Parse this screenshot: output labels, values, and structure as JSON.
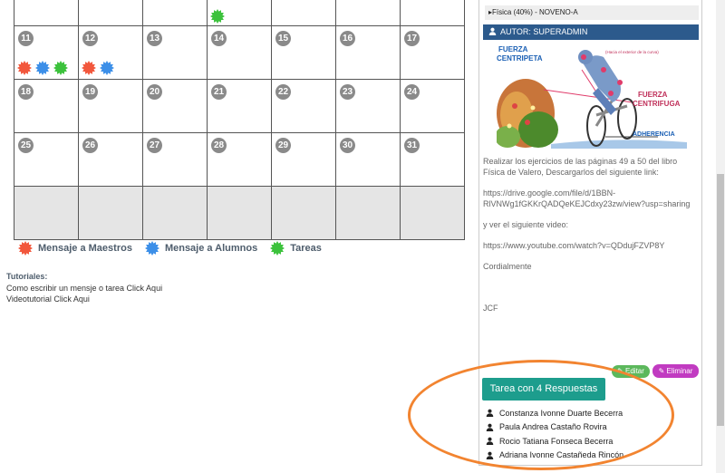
{
  "calendar": {
    "top_row": [
      {
        "day": "",
        "badges": []
      },
      {
        "day": "",
        "badges": []
      },
      {
        "day": "",
        "badges": []
      },
      {
        "day": "",
        "badges": [
          "green"
        ]
      },
      {
        "day": "",
        "badges": []
      },
      {
        "day": "",
        "badges": []
      },
      {
        "day": "",
        "badges": []
      }
    ],
    "weeks": [
      [
        {
          "day": "11",
          "badges": [
            "red",
            "blue",
            "green"
          ]
        },
        {
          "day": "12",
          "badges": [
            "red",
            "blue"
          ]
        },
        {
          "day": "13",
          "badges": []
        },
        {
          "day": "14",
          "badges": []
        },
        {
          "day": "15",
          "badges": []
        },
        {
          "day": "16",
          "badges": []
        },
        {
          "day": "17",
          "badges": []
        }
      ],
      [
        {
          "day": "18",
          "badges": []
        },
        {
          "day": "19",
          "badges": []
        },
        {
          "day": "20",
          "badges": []
        },
        {
          "day": "21",
          "badges": []
        },
        {
          "day": "22",
          "badges": []
        },
        {
          "day": "23",
          "badges": []
        },
        {
          "day": "24",
          "badges": []
        }
      ],
      [
        {
          "day": "25",
          "badges": []
        },
        {
          "day": "26",
          "badges": []
        },
        {
          "day": "27",
          "badges": []
        },
        {
          "day": "28",
          "badges": []
        },
        {
          "day": "29",
          "badges": []
        },
        {
          "day": "30",
          "badges": []
        },
        {
          "day": "31",
          "badges": []
        }
      ]
    ]
  },
  "legend": {
    "teachers": "Mensaje a Maestros",
    "students": "Mensaje a Alumnos",
    "tasks": "Tareas"
  },
  "colors": {
    "red": "#f2573c",
    "blue": "#3c8fe8",
    "green": "#3cc23c",
    "author_bar": "#2c5a8c",
    "answers_button": "#1d9d8d",
    "edit": "#5cb85c",
    "delete": "#c13bc1",
    "highlight": "#f28430"
  },
  "tutorials": {
    "title": "Tutoriales:",
    "link_write": "Como escribir un mensje o tarea Click Aqui",
    "link_video": "Videotutorial Click Aqui"
  },
  "panel": {
    "subject": "▸Física (40%) - NOVENO-A",
    "author": "AUTOR: SUPERADMIN",
    "illustration": {
      "label_centripeta_1": "FUERZA",
      "label_centripeta_2": "CENTRIPETA",
      "label_exterior": "(Hacia el exterior de la curva)",
      "label_centrifuga_1": "FUERZA",
      "label_centrifuga_2": "CENTRIFUGA",
      "label_adherencia": "ADHERENCIA"
    },
    "paragraphs": [
      "Realizar los ejercicios de las páginas 49 a 50 del libro Física de Valero, Descargarlos del siguiente link:",
      "https://drive.google.com/file/d/1BBN-RlVNWg1fGKKrQADQeKEJCdxy23zw/view?usp=sharing",
      "y ver el siguiente video:",
      "https://www.youtube.com/watch?v=QDdujFZVP8Y",
      "Cordialmente",
      "",
      "JCF"
    ],
    "edit_label": "Editar",
    "delete_label": "Eliminar",
    "answers_label": "Tarea con 4 Respuestas",
    "students": [
      "Constanza Ivonne Duarte Becerra",
      "Paula Andrea Castaño Rovira",
      "Rocio Tatiana Fonseca Becerra",
      "Adriana Ivonne Castañeda Rincón"
    ]
  }
}
